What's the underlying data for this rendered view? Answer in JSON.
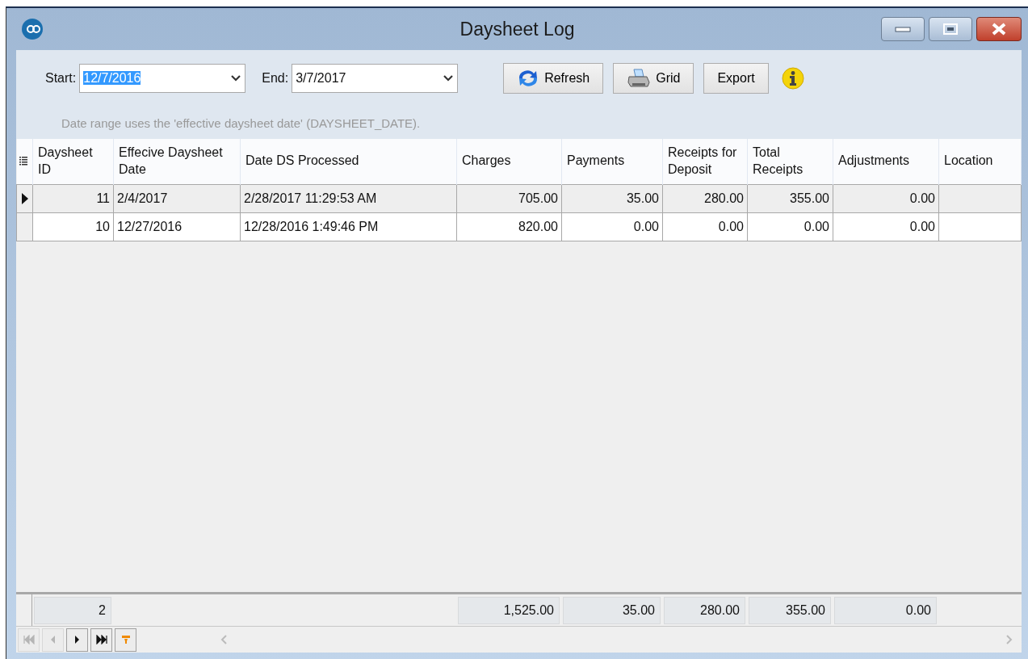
{
  "window": {
    "title": "Daysheet Log"
  },
  "filters": [
    {
      "kind": "date",
      "label": "Start:",
      "value": "12/7/2016",
      "highlighted": true
    },
    {
      "kind": "date",
      "label": "End:",
      "value": "3/7/2017",
      "highlighted": false
    }
  ],
  "buttons": [
    {
      "kind": "refresh",
      "label": "Refresh"
    },
    {
      "kind": "print",
      "label": "Grid"
    },
    {
      "kind": "plain",
      "label": "Export"
    }
  ],
  "note": "Date range uses the 'effective daysheet date' (DAYSHEET_DATE).",
  "table": {
    "columns": [
      {
        "label": "Daysheet ID",
        "kind": "number"
      },
      {
        "label": "Effecive Daysheet Date",
        "kind": "text"
      },
      {
        "label": "Date DS Processed",
        "kind": "text"
      },
      {
        "label": "Charges",
        "kind": "number"
      },
      {
        "label": "Payments",
        "kind": "number"
      },
      {
        "label": "Receipts for Deposit",
        "kind": "number"
      },
      {
        "label": "Total Receipts",
        "kind": "number"
      },
      {
        "label": "Adjustments",
        "kind": "number"
      },
      {
        "label": "Location",
        "kind": "text"
      }
    ],
    "rows": [
      {
        "selected": true,
        "cells": [
          "11",
          "2/4/2017",
          "2/28/2017 11:29:53 AM",
          "705.00",
          "35.00",
          "280.00",
          "355.00",
          "0.00",
          ""
        ]
      },
      {
        "selected": false,
        "cells": [
          "10",
          "12/27/2016",
          "12/28/2016 1:49:46 PM",
          "820.00",
          "0.00",
          "0.00",
          "0.00",
          "0.00",
          ""
        ]
      }
    ],
    "totals": {
      "daysheet_id": "2",
      "charges": "1,525.00",
      "payments": "35.00",
      "receipts_for_deposit": "280.00",
      "total_receipts": "355.00",
      "adjustments": "0.00"
    }
  },
  "navigator": [
    {
      "kind": "first",
      "disabled": true
    },
    {
      "kind": "prev",
      "disabled": true
    },
    {
      "kind": "next",
      "disabled": false
    },
    {
      "kind": "last",
      "disabled": false
    },
    {
      "kind": "filter",
      "disabled": false
    }
  ]
}
